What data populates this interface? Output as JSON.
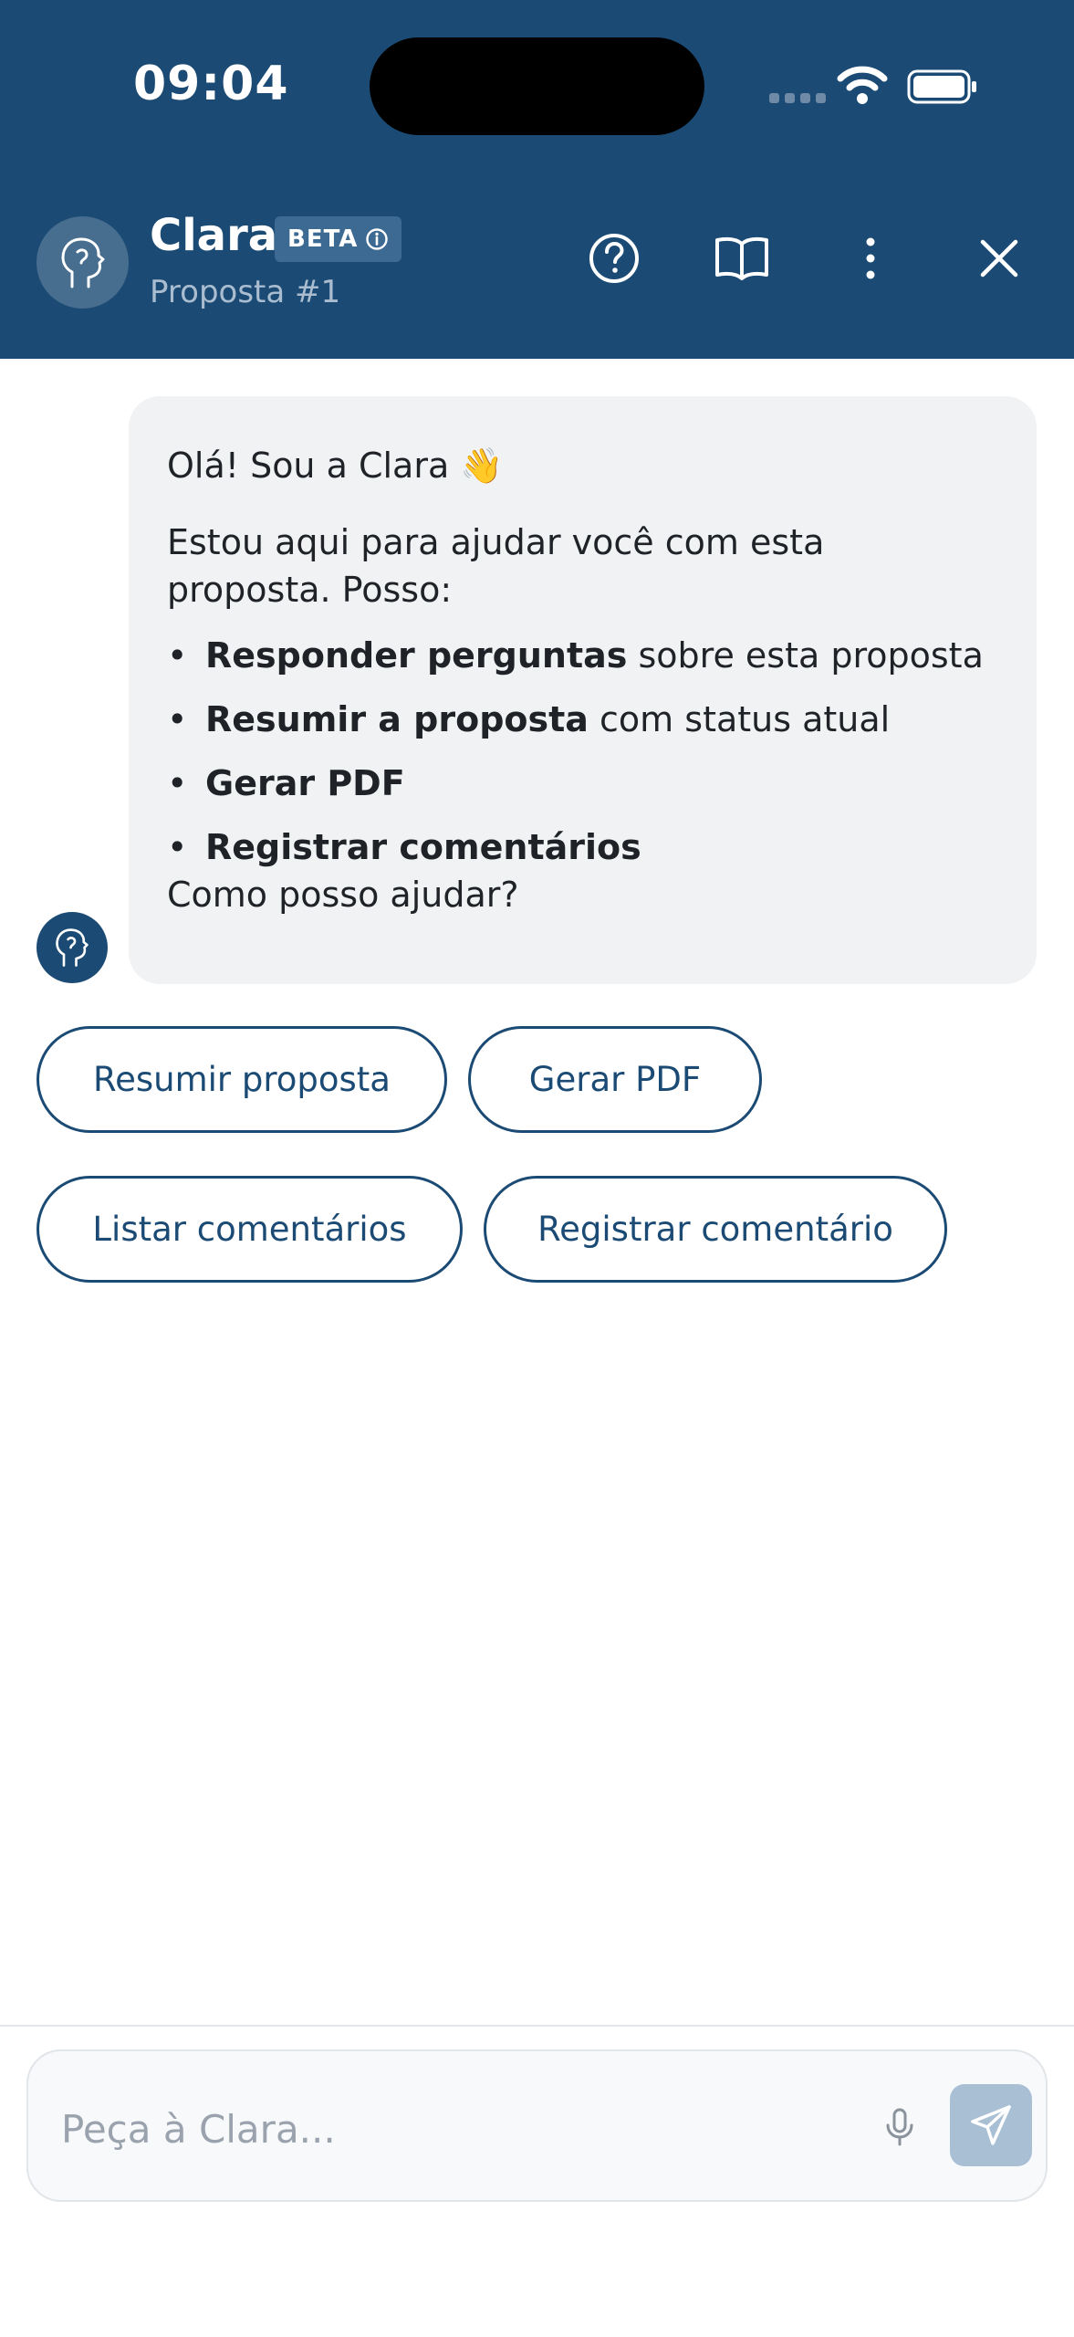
{
  "status_bar": {
    "time": "09:04"
  },
  "header": {
    "title": "Clara",
    "badge": "BETA",
    "subtitle": "Proposta #1",
    "icons": [
      "help-icon",
      "book-icon",
      "more-icon",
      "close-icon"
    ]
  },
  "message": {
    "greeting": "Olá! Sou a Clara 👋",
    "intro": "Estou aqui para ajudar você com esta proposta. Posso:",
    "items": [
      {
        "bold": "Responder perguntas",
        "rest": " sobre esta proposta"
      },
      {
        "bold": "Resumir a proposta",
        "rest": " com status atual"
      },
      {
        "bold": "Gerar PDF",
        "rest": ""
      },
      {
        "bold": "Registrar comentários",
        "rest": ""
      }
    ],
    "closing": "Como posso ajudar?"
  },
  "chips": [
    "Resumir proposta",
    "Gerar PDF",
    "Listar comentários",
    "Registrar comentário"
  ],
  "input": {
    "placeholder": "Peça à Clara...",
    "value": ""
  },
  "colors": {
    "header_bg": "#1b4b74",
    "accent": "#1b4b74",
    "bubble_bg": "#f1f2f4",
    "send_disabled": "#a9bfd4"
  }
}
